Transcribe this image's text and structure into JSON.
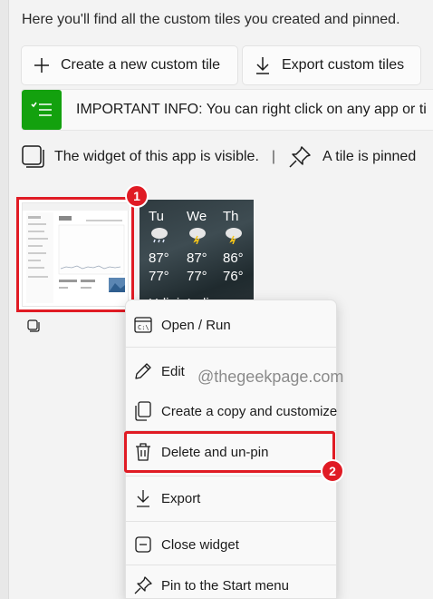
{
  "intro_text": "Here you'll find all the custom tiles you created and pinned.",
  "toolbar": {
    "create_label": "Create a new custom tile",
    "export_label": "Export custom tiles"
  },
  "info_bar": {
    "text": "IMPORTANT INFO: You can right click on any app or ti",
    "icon": "checklist-icon",
    "icon_color": "#13a10e"
  },
  "legend": {
    "widget_visible": "The widget of this app is visible.",
    "separator": "|",
    "tile_pinned": "A tile is pinned"
  },
  "weather_tile": {
    "days": [
      {
        "day": "Tu",
        "hi": "87°",
        "lo": "77°"
      },
      {
        "day": "We",
        "hi": "87°",
        "lo": "77°"
      },
      {
        "day": "Th",
        "hi": "86°",
        "lo": "76°"
      }
    ],
    "city": "Udipi, India"
  },
  "badges": {
    "first": "1",
    "second": "2",
    "color": "#e01b24"
  },
  "context_menu": {
    "items": [
      {
        "label": "Open / Run",
        "icon": "run-icon"
      },
      {
        "label": "Edit",
        "icon": "pencil-icon"
      },
      {
        "label": "Create a copy and customize",
        "icon": "copy-icon"
      },
      {
        "label": "Delete and un-pin",
        "icon": "trash-icon"
      },
      {
        "label": "Export",
        "icon": "download-icon"
      },
      {
        "label": "Close widget",
        "icon": "close-widget-icon"
      },
      {
        "label": "Pin to the Start menu",
        "icon": "pin-icon"
      }
    ]
  },
  "watermark": "@thegeekpage.com"
}
